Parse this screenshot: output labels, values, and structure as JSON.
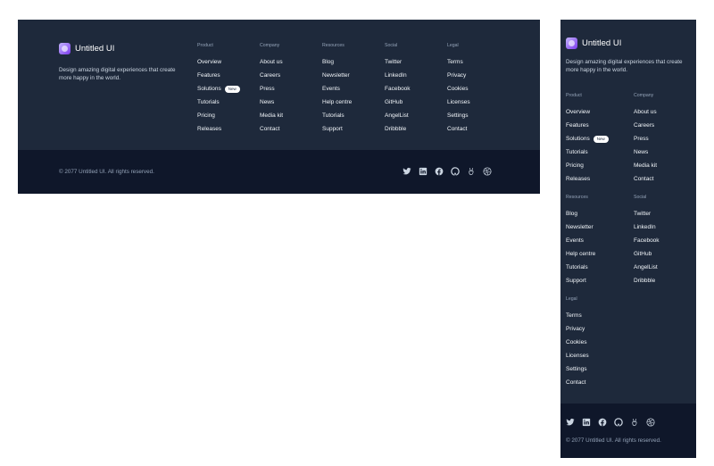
{
  "brand": {
    "name": "Untitled UI",
    "tagline": "Design amazing digital experiences that create more happy in the world."
  },
  "columns": {
    "product": {
      "heading": "Product",
      "links": [
        "Overview",
        "Features",
        "Solutions",
        "Tutorials",
        "Pricing",
        "Releases"
      ],
      "badge": "New"
    },
    "company": {
      "heading": "Company",
      "links": [
        "About us",
        "Careers",
        "Press",
        "News",
        "Media kit",
        "Contact"
      ]
    },
    "resources": {
      "heading": "Resources",
      "links": [
        "Blog",
        "Newsletter",
        "Events",
        "Help centre",
        "Tutorials",
        "Support"
      ]
    },
    "social": {
      "heading": "Social",
      "links": [
        "Twitter",
        "LinkedIn",
        "Facebook",
        "GitHub",
        "AngelList",
        "Dribbble"
      ]
    },
    "legal": {
      "heading": "Legal",
      "links": [
        "Terms",
        "Privacy",
        "Cookies",
        "Licenses",
        "Settings",
        "Contact"
      ]
    }
  },
  "copyright": "© 2077 Untitled UI. All rights reserved.",
  "social_icons": [
    "twitter-icon",
    "linkedin-icon",
    "facebook-icon",
    "github-icon",
    "angellist-icon",
    "dribbble-icon"
  ],
  "colors": {
    "footer_bg": "#1e293b",
    "footer_bottom_bg": "#0f172a",
    "text": "#ffffff",
    "muted": "#94a3b8",
    "logo": "#7c3aed"
  }
}
